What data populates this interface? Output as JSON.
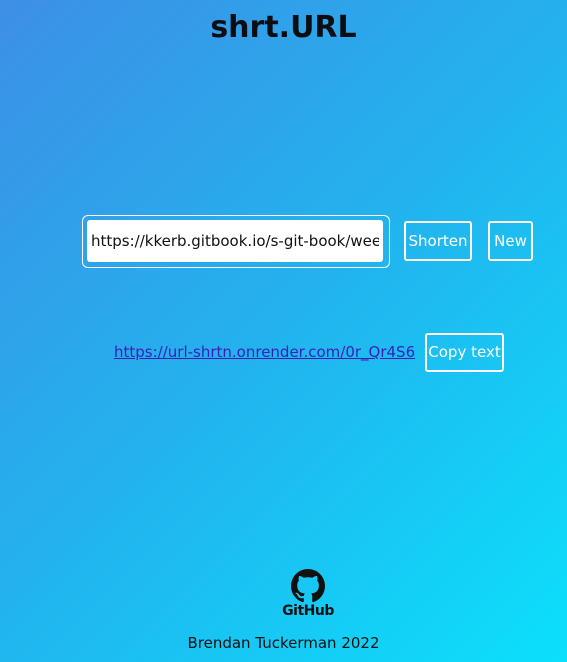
{
  "header": {
    "title": "shrt.URL"
  },
  "form": {
    "url_value": "https://kkerb.gitbook.io/s-git-book/week-",
    "shorten_label": "Shorten",
    "new_label": "New"
  },
  "result": {
    "short_url": "https://url-shrtn.onrender.com/0r_Qr4S6",
    "copy_label": "Copy text"
  },
  "footer": {
    "github_label": "GitHub",
    "credit": "Brendan Tuckerman 2022"
  },
  "colors": {
    "gradient_start": "#3d8fe6",
    "gradient_end": "#0be0fb",
    "link": "#3a1fb6",
    "button_border": "#ffffff"
  }
}
